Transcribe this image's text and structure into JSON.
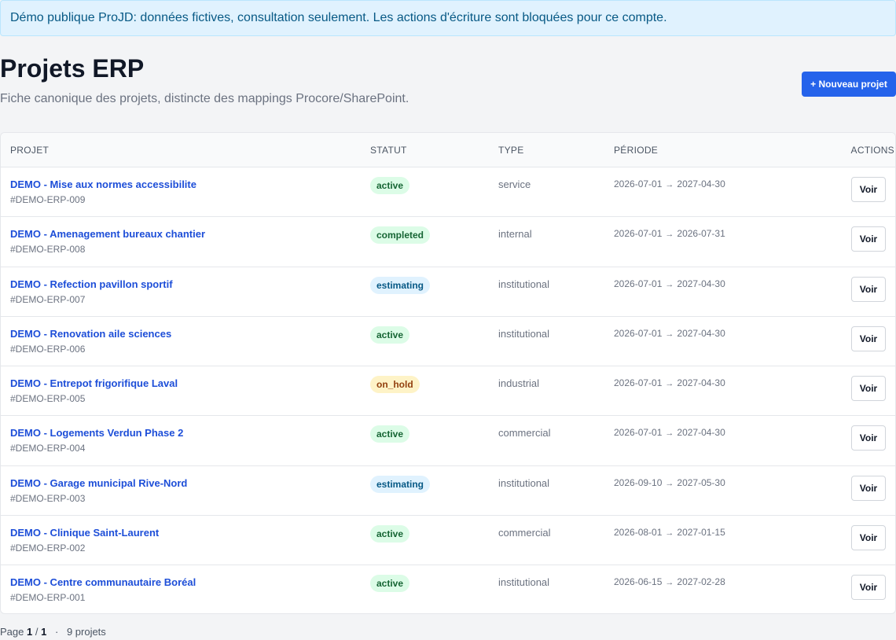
{
  "banner": {
    "text": "Démo publique ProJD: données fictives, consultation seulement. Les actions d'écriture sont bloquées pour ce compte."
  },
  "header": {
    "title": "Projets ERP",
    "subtitle": "Fiche canonique des projets, distincte des mappings Procore/SharePoint.",
    "new_button": "+ Nouveau projet"
  },
  "table": {
    "columns": {
      "projet": "PROJET",
      "statut": "STATUT",
      "type": "TYPE",
      "periode": "PÉRIODE",
      "actions": "ACTIONS"
    },
    "arrow": "→",
    "view_label": "Voir",
    "rows": [
      {
        "name": "DEMO - Mise aux normes accessibilite",
        "code": "#DEMO-ERP-009",
        "status": "active",
        "type": "service",
        "start": "2026-07-01",
        "end": "2027-04-30"
      },
      {
        "name": "DEMO - Amenagement bureaux chantier",
        "code": "#DEMO-ERP-008",
        "status": "completed",
        "type": "internal",
        "start": "2026-07-01",
        "end": "2026-07-31"
      },
      {
        "name": "DEMO - Refection pavillon sportif",
        "code": "#DEMO-ERP-007",
        "status": "estimating",
        "type": "institutional",
        "start": "2026-07-01",
        "end": "2027-04-30"
      },
      {
        "name": "DEMO - Renovation aile sciences",
        "code": "#DEMO-ERP-006",
        "status": "active",
        "type": "institutional",
        "start": "2026-07-01",
        "end": "2027-04-30"
      },
      {
        "name": "DEMO - Entrepot frigorifique Laval",
        "code": "#DEMO-ERP-005",
        "status": "on_hold",
        "type": "industrial",
        "start": "2026-07-01",
        "end": "2027-04-30"
      },
      {
        "name": "DEMO - Logements Verdun Phase 2",
        "code": "#DEMO-ERP-004",
        "status": "active",
        "type": "commercial",
        "start": "2026-07-01",
        "end": "2027-04-30"
      },
      {
        "name": "DEMO - Garage municipal Rive-Nord",
        "code": "#DEMO-ERP-003",
        "status": "estimating",
        "type": "institutional",
        "start": "2026-09-10",
        "end": "2027-05-30"
      },
      {
        "name": "DEMO - Clinique Saint-Laurent",
        "code": "#DEMO-ERP-002",
        "status": "active",
        "type": "commercial",
        "start": "2026-08-01",
        "end": "2027-01-15"
      },
      {
        "name": "DEMO - Centre communautaire Boréal",
        "code": "#DEMO-ERP-001",
        "status": "active",
        "type": "institutional",
        "start": "2026-06-15",
        "end": "2027-02-28"
      }
    ]
  },
  "pager": {
    "page_label": "Page",
    "current": "1",
    "separator": "/",
    "total": "1",
    "dot": "·",
    "count_text": "9 projets"
  },
  "colors": {
    "accent": "#2563eb",
    "link": "#1d4ed8",
    "banner_bg": "#e0f2fe"
  }
}
